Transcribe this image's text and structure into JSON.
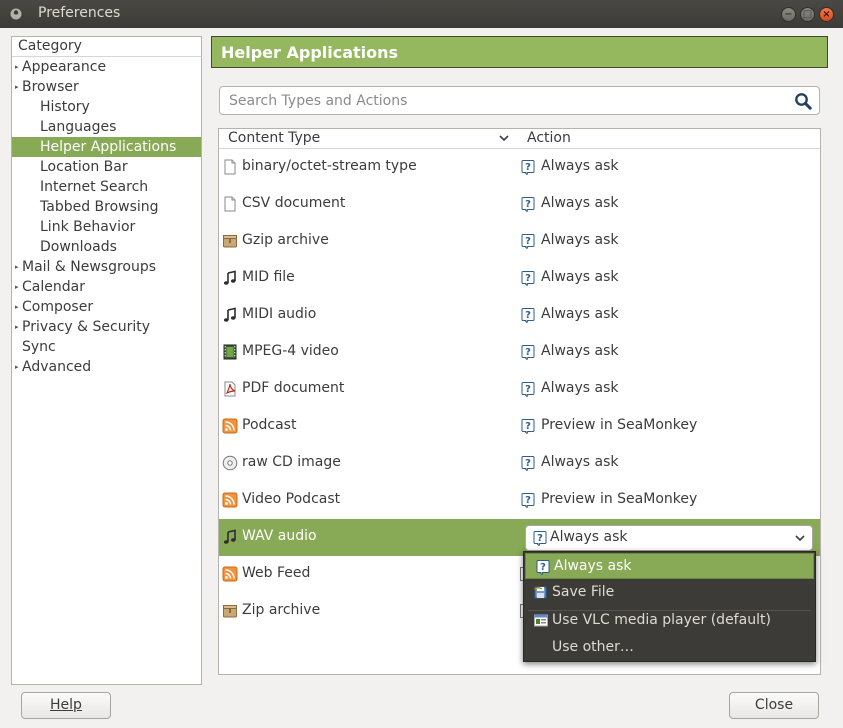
{
  "window": {
    "title": "Preferences",
    "close_glyph": "×",
    "minimize_glyph": "−",
    "maximize_glyph": "□"
  },
  "category": {
    "header": "Category",
    "items": [
      {
        "label": "Appearance",
        "expandable": true,
        "indent": 0
      },
      {
        "label": "Browser",
        "expandable": true,
        "indent": 0
      },
      {
        "label": "History",
        "expandable": false,
        "indent": 1
      },
      {
        "label": "Languages",
        "expandable": false,
        "indent": 1
      },
      {
        "label": "Helper Applications",
        "expandable": false,
        "indent": 1,
        "selected": true
      },
      {
        "label": "Location Bar",
        "expandable": false,
        "indent": 1
      },
      {
        "label": "Internet Search",
        "expandable": false,
        "indent": 1
      },
      {
        "label": "Tabbed Browsing",
        "expandable": false,
        "indent": 1
      },
      {
        "label": "Link Behavior",
        "expandable": false,
        "indent": 1
      },
      {
        "label": "Downloads",
        "expandable": false,
        "indent": 1
      },
      {
        "label": "Mail & Newsgroups",
        "expandable": true,
        "indent": 0
      },
      {
        "label": "Calendar",
        "expandable": true,
        "indent": 0
      },
      {
        "label": "Composer",
        "expandable": true,
        "indent": 0
      },
      {
        "label": "Privacy & Security",
        "expandable": true,
        "indent": 0
      },
      {
        "label": "Sync",
        "expandable": false,
        "indent": 0
      },
      {
        "label": "Advanced",
        "expandable": true,
        "indent": 0
      }
    ]
  },
  "pane": {
    "title": "Helper Applications"
  },
  "search": {
    "placeholder": "Search Types and Actions"
  },
  "table": {
    "headers": {
      "content_type": "Content Type",
      "action": "Action"
    },
    "rows": [
      {
        "type": "binary/octet-stream type",
        "type_icon": "generic-file-icon",
        "action": "Always ask",
        "action_icon": "always-ask-icon"
      },
      {
        "type": "CSV document",
        "type_icon": "generic-file-icon",
        "action": "Always ask",
        "action_icon": "always-ask-icon"
      },
      {
        "type": "Gzip archive",
        "type_icon": "archive-icon",
        "action": "Always ask",
        "action_icon": "always-ask-icon"
      },
      {
        "type": "MID file",
        "type_icon": "music-note-icon",
        "action": "Always ask",
        "action_icon": "always-ask-icon"
      },
      {
        "type": "MIDI audio",
        "type_icon": "music-note-icon",
        "action": "Always ask",
        "action_icon": "always-ask-icon"
      },
      {
        "type": "MPEG-4 video",
        "type_icon": "film-icon",
        "action": "Always ask",
        "action_icon": "always-ask-icon"
      },
      {
        "type": "PDF document",
        "type_icon": "pdf-icon",
        "action": "Always ask",
        "action_icon": "always-ask-icon"
      },
      {
        "type": "Podcast",
        "type_icon": "rss-feed-icon",
        "action": "Preview in SeaMonkey",
        "action_icon": "always-ask-icon"
      },
      {
        "type": "raw CD image",
        "type_icon": "cd-icon",
        "action": "Always ask",
        "action_icon": "always-ask-icon"
      },
      {
        "type": "Video Podcast",
        "type_icon": "rss-feed-icon",
        "action": "Preview in SeaMonkey",
        "action_icon": "always-ask-icon"
      },
      {
        "type": "WAV audio",
        "type_icon": "music-note-icon",
        "action": "Always ask",
        "action_icon": "always-ask-icon",
        "selected": true
      },
      {
        "type": "Web Feed",
        "type_icon": "rss-feed-icon",
        "action": "",
        "action_icon": ""
      },
      {
        "type": "Zip archive",
        "type_icon": "archive-icon",
        "action": "",
        "action_icon": ""
      }
    ]
  },
  "dropdown": {
    "selected_value": "Always ask",
    "options": [
      {
        "label": "Always ask",
        "icon": "always-ask-icon",
        "highlighted": true
      },
      {
        "label": "Save File",
        "icon": "save-file-icon"
      },
      {
        "label": "Use VLC media player (default)",
        "icon": "vlc-app-icon"
      },
      {
        "label": "Use other…",
        "icon": ""
      }
    ]
  },
  "buttons": {
    "help_label": "Help",
    "close_label": "Close"
  },
  "colors": {
    "accent": "#88a956",
    "pane_title_bg": "#95b85e",
    "titlebar": "#3c3b37",
    "window_bg": "#f2f1f0"
  }
}
